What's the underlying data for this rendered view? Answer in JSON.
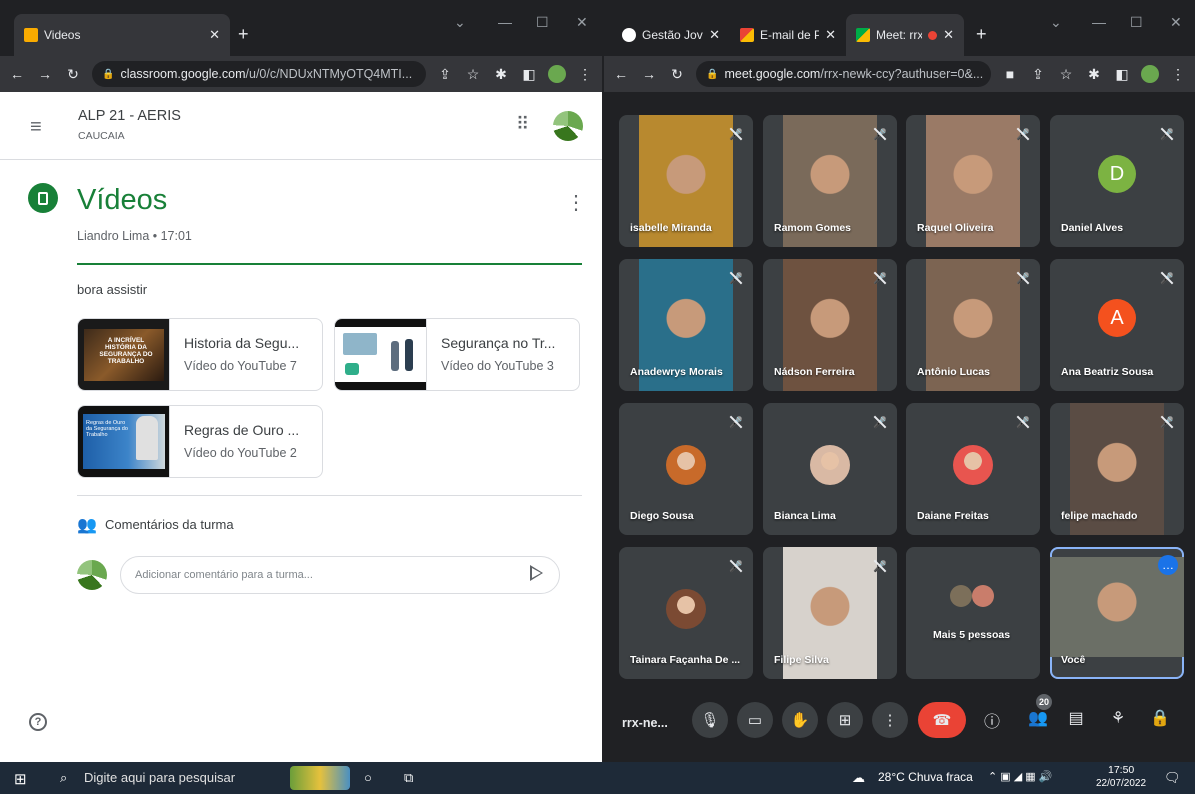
{
  "left_window": {
    "tab_title": "Videos",
    "url_host": "classroom.google.com",
    "url_path": "/u/0/c/NDUxNTMyOTQ4MTI...",
    "course": "ALP 21 - AERIS",
    "course_sub": "CAUCAIA",
    "post_title": "Vídeos",
    "post_meta": "Liandro Lima • 17:01",
    "post_body": "bora assistir",
    "attachments": [
      {
        "title": "Historia da Segu...",
        "subtitle": "Vídeo do YouTube   7",
        "thumb_text": "A INCRÍVEL HISTÓRIA DA SEGURANÇA DO TRABALHO"
      },
      {
        "title": "Segurança no Tr...",
        "subtitle": "Vídeo do YouTube   3"
      },
      {
        "title": "Regras de Ouro ...",
        "subtitle": "Vídeo do YouTube   2",
        "thumb_text": "Regras de Ouro da Segurança do Trabalho"
      }
    ],
    "comments_label": "Comentários da turma",
    "comment_placeholder": "Adicionar comentário para a turma...",
    "help_icon_glyph": "?"
  },
  "right_window": {
    "tabs": [
      {
        "label": "Gestão Jovem",
        "icon": "github-icon"
      },
      {
        "label": "E-mail de Po",
        "icon": "gmail-icon"
      },
      {
        "label": "Meet: rrx",
        "icon": "meet-icon"
      }
    ],
    "url_host": "meet.google.com",
    "url_path": "/rrx-newk-ccy?authuser=0&...",
    "participants": [
      {
        "name": "isabelle Miranda",
        "type": "video",
        "color": "#b8892f"
      },
      {
        "name": "Ramom Gomes",
        "type": "video",
        "color": "#7a6a5a"
      },
      {
        "name": "Raquel Oliveira",
        "type": "video",
        "color": "#9a7a66"
      },
      {
        "name": "Daniel Alves",
        "type": "letter",
        "letter": "D",
        "color": "#7cb342"
      },
      {
        "name": "Anadewrys Morais",
        "type": "video",
        "color": "#2a6f8a"
      },
      {
        "name": "Nádson Ferreira",
        "type": "video",
        "color": "#6e5240"
      },
      {
        "name": "Antônio Lucas",
        "type": "video",
        "color": "#7c6452"
      },
      {
        "name": "Ana Beatriz Sousa",
        "type": "letter",
        "letter": "A",
        "color": "#f4511e"
      },
      {
        "name": "Diego Sousa",
        "type": "avatar",
        "color": "#c86a2a"
      },
      {
        "name": "Bianca Lima",
        "type": "avatar",
        "color": "#d9b9a4"
      },
      {
        "name": "Daiane Freitas",
        "type": "avatar",
        "color": "#e8554f"
      },
      {
        "name": "felipe machado",
        "type": "video",
        "color": "#5a4c44"
      },
      {
        "name": "Tainara Façanha De ...",
        "type": "avatar",
        "color": "#7b4a33"
      },
      {
        "name": "Filipe Silva",
        "type": "video",
        "color": "#d7d2cc"
      },
      {
        "name": "Mais 5 pessoas",
        "type": "more",
        "color": "#3c4043"
      },
      {
        "name": "Você",
        "type": "self",
        "color": "#6b6f66"
      }
    ],
    "meeting_code": "rrx-ne...",
    "participant_count": "20",
    "leave_color": "#ea4335"
  },
  "taskbar": {
    "search_placeholder": "Digite aqui para pesquisar",
    "weather": "28°C  Chuva fraca",
    "time": "17:50",
    "date": "22/07/2022"
  }
}
